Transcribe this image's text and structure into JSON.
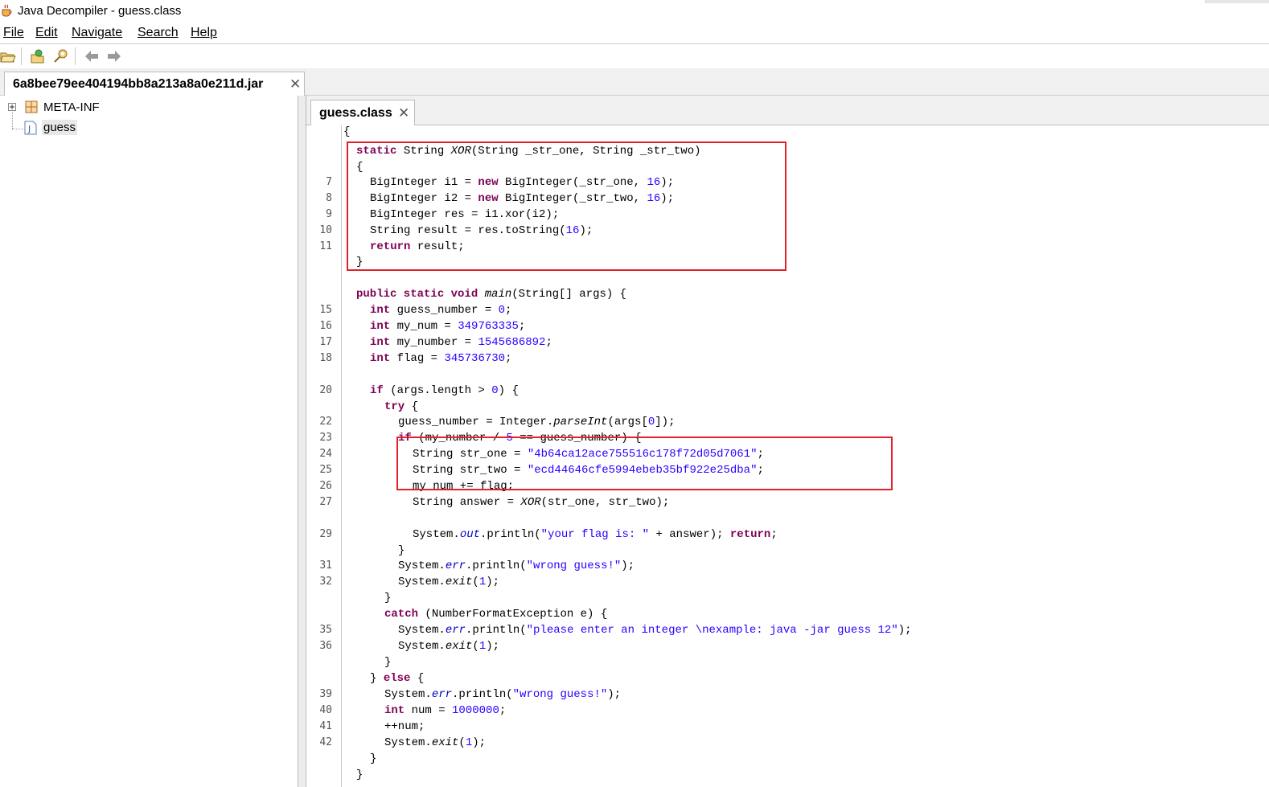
{
  "window": {
    "title": "Java Decompiler - guess.class"
  },
  "menu": [
    "File",
    "Edit",
    "Navigate",
    "Search",
    "Help"
  ],
  "jar_tab": {
    "label": "6a8bee79ee404194bb8a213a8a0e211d.jar"
  },
  "tree": {
    "items": [
      "META-INF",
      "guess"
    ]
  },
  "editor_tab": {
    "label": "guess.class"
  },
  "code": {
    "line_numbers": [
      "7",
      "8",
      "9",
      "10",
      "11",
      "15",
      "16",
      "17",
      "18",
      "20",
      "22",
      "23",
      "24",
      "25",
      "26",
      "27",
      "29",
      "31",
      "32",
      "35",
      "36",
      "39",
      "40",
      "41",
      "42"
    ],
    "xor_sig": "static String XOR(String _str_one, String _str_two)",
    "v_349763335": "349763335",
    "v_1545686892": "1545686892",
    "v_345736730": "345736730",
    "str_one": "\"4b64ca12ace755516c178f72d05d7061\"",
    "str_two": "\"ecd44646cfe5994ebeb35bf922e25dba\"",
    "flag_msg": "\"your flag is: \"",
    "wrong_msg": "\"wrong guess!\"",
    "usage_msg": "\"please enter an integer \\nexample: java -jar guess 12\"",
    "v_1000000": "1000000"
  },
  "highlight_color": "#e1212c"
}
